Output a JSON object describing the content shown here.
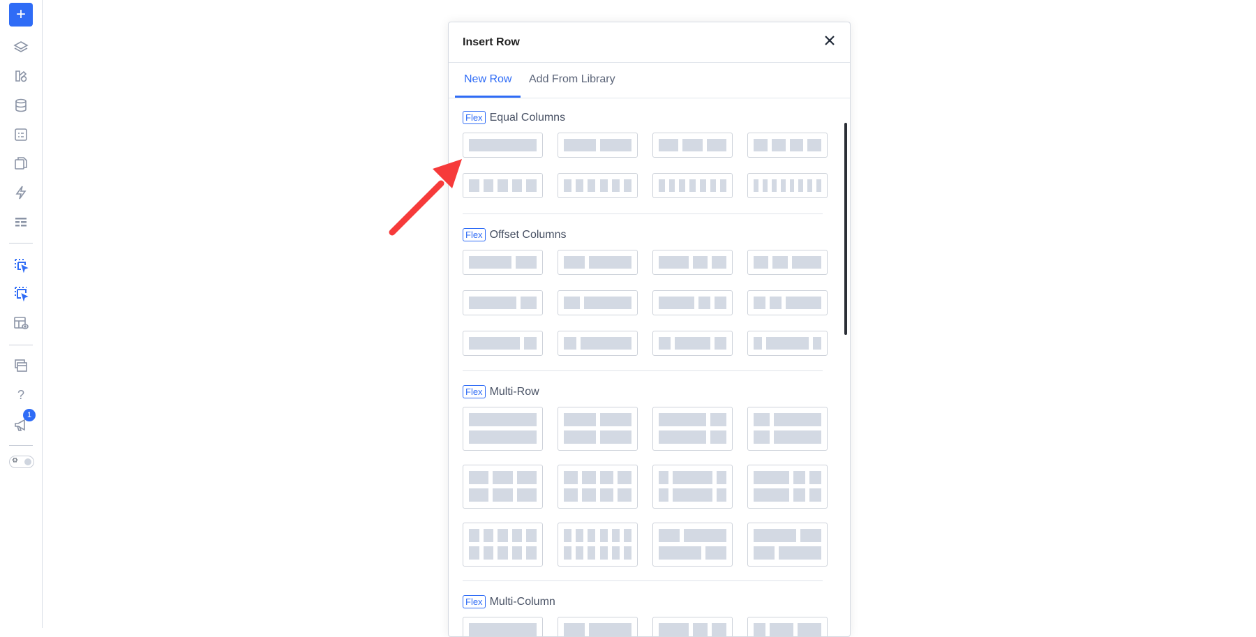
{
  "sidebar": {
    "add_label": "+",
    "icons": [
      "layers-icon",
      "elements-icon",
      "database-icon",
      "forms-icon",
      "pages-icon",
      "actions-icon",
      "table-icon",
      "select-element-icon",
      "select-multi-icon",
      "template-preview-icon",
      "windows-icon",
      "help-icon",
      "announcement-icon"
    ],
    "help_glyph": "?",
    "badge_count": "1",
    "accent": "#2f6cf6"
  },
  "modal": {
    "title": "Insert Row",
    "tabs": [
      {
        "label": "New Row",
        "active": true
      },
      {
        "label": "Add From Library",
        "active": false
      }
    ],
    "sections": [
      {
        "badge": "Flex",
        "title": "Equal Columns"
      },
      {
        "badge": "Flex",
        "title": "Offset Columns"
      },
      {
        "badge": "Flex",
        "title": "Multi-Row"
      },
      {
        "badge": "Flex",
        "title": "Multi-Column"
      }
    ]
  },
  "annotation": {
    "color": "#f63a3a",
    "icon": "red-arrow"
  }
}
